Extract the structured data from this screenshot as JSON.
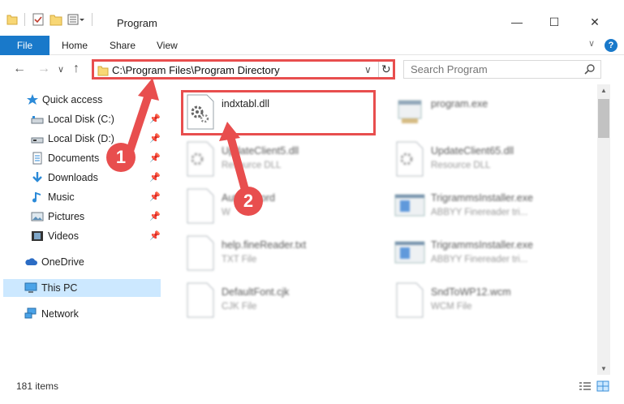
{
  "window": {
    "title": "Program",
    "minimize_glyph": "—",
    "maximize_glyph": "☐",
    "close_glyph": "✕"
  },
  "ribbon": {
    "tabs": [
      {
        "label": "File"
      },
      {
        "label": "Home"
      },
      {
        "label": "Share"
      },
      {
        "label": "View"
      }
    ],
    "help_glyph": "?",
    "collapse_glyph": "∨"
  },
  "nav": {
    "back_glyph": "←",
    "forward_glyph": "→",
    "recent_glyph": "∨",
    "up_glyph": "↑"
  },
  "address": {
    "path": "C:\\Program Files\\Program Directory",
    "dropdown_glyph": "∨",
    "refresh_glyph": "↻"
  },
  "search": {
    "placeholder": "Search Program"
  },
  "sidebar": {
    "items": [
      {
        "label": "Quick access",
        "icon": "star-icon",
        "pinned": false
      },
      {
        "label": "Local Disk (C:)",
        "icon": "drive-icon",
        "pinned": true
      },
      {
        "label": "Local Disk (D:)",
        "icon": "drive-icon",
        "pinned": true
      },
      {
        "label": "Documents",
        "icon": "documents-icon",
        "pinned": true
      },
      {
        "label": "Downloads",
        "icon": "download-icon",
        "pinned": true
      },
      {
        "label": "Music",
        "icon": "music-icon",
        "pinned": true
      },
      {
        "label": "Pictures",
        "icon": "pictures-icon",
        "pinned": true
      },
      {
        "label": "Videos",
        "icon": "videos-icon",
        "pinned": true
      },
      {
        "label": "OneDrive",
        "icon": "cloud-icon",
        "pinned": false
      },
      {
        "label": "This PC",
        "icon": "computer-icon",
        "pinned": false,
        "selected": true
      },
      {
        "label": "Network",
        "icon": "network-icon",
        "pinned": false
      }
    ],
    "pin_glyph": "📌"
  },
  "files": [
    {
      "name": "indxtabl.dll",
      "type": "",
      "icon": "dll-gear-icon",
      "highlighted": true
    },
    {
      "name": "program.exe",
      "type": "",
      "icon": "exe-icon"
    },
    {
      "name": "UpdateClient5.dll",
      "type": "Resource DLL",
      "icon": "dll-gear-icon"
    },
    {
      "name": "UpdateClient65.dll",
      "type": "Resource DLL",
      "icon": "dll-gear-icon"
    },
    {
      "name": "AutoRecord",
      "type": "W",
      "icon": "file-icon"
    },
    {
      "name": "TrigrammsInstaller.exe",
      "type": "ABBYY Finereader tri...",
      "icon": "installer-icon"
    },
    {
      "name": "help.fineReader.txt",
      "type": "TXT File",
      "icon": "file-icon"
    },
    {
      "name": "TrigrammsInstaller.exe",
      "type": "ABBYY Finereader tri...",
      "icon": "installer-icon"
    },
    {
      "name": "DefaultFont.cjk",
      "type": "CJK File",
      "icon": "file-icon"
    },
    {
      "name": "SndToWP12.wcm",
      "type": "WCM File",
      "icon": "file-icon"
    }
  ],
  "status": {
    "item_count": "181 items"
  },
  "annotations": {
    "step1": "1",
    "step2": "2",
    "color": "#e84e4e"
  }
}
